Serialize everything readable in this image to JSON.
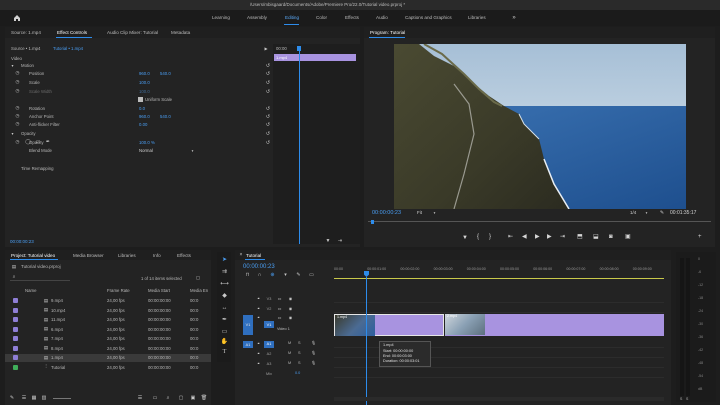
{
  "titlebar": {
    "path": "/Users/mbisgaard/Documents/Adobe/Premiere Pro/22.0/Tutorial video.prproj *"
  },
  "workspaces": [
    "Learning",
    "Assembly",
    "Editing",
    "Color",
    "Effects",
    "Audio",
    "Captions and Graphics",
    "Libraries"
  ],
  "workspace_active": "Editing",
  "source_tabs": [
    "Source: 1.mp4",
    "Effect Controls",
    "Audio Clip Mixer: Tutorial",
    "Metadata"
  ],
  "effect_controls": {
    "header": "Source • 1.mp4",
    "header_link": "Tutorial • 1.mp4",
    "section": "Video",
    "rows": [
      {
        "label": "Motion",
        "value": "",
        "value2": ""
      },
      {
        "label": "Position",
        "value": "960.0",
        "value2": "540.0"
      },
      {
        "label": "Scale",
        "value": "100.0",
        "value2": ""
      },
      {
        "label": "Scale Width",
        "value": "100.0",
        "value2": ""
      },
      {
        "label": "Uniform Scale",
        "value": "",
        "value2": ""
      },
      {
        "label": "Rotation",
        "value": "0.0",
        "value2": ""
      },
      {
        "label": "Anchor Point",
        "value": "960.0",
        "value2": "540.0"
      },
      {
        "label": "Anti-flicker Filter",
        "value": "0.00",
        "value2": ""
      },
      {
        "label": "Opacity",
        "value": "",
        "value2": ""
      },
      {
        "label": "Opacity",
        "value": "100.0 %",
        "value2": ""
      },
      {
        "label": "Blend Mode",
        "value": "Normal",
        "value2": ""
      },
      {
        "label": "Time Remapping",
        "value": "",
        "value2": ""
      }
    ],
    "mini_time": "00:00",
    "mini_clip": "1.mp4",
    "timecode": "00:00:00:23"
  },
  "program": {
    "title": "Program: Tutorial",
    "timecode": "00:00:00:23",
    "fit": "Fit",
    "fraction": "1/4",
    "duration": "00:01:35:17"
  },
  "project": {
    "tabs": [
      "Project: Tutorial video",
      "Media Browser",
      "Libraries",
      "Info",
      "Effects"
    ],
    "file": "Tutorial video.prproj",
    "selected_count": "1 of 14 items selected",
    "columns": [
      "Name",
      "Frame Rate",
      "Media Start",
      "Media En"
    ],
    "items": [
      {
        "name": "9.mp4",
        "rate": "24,00 fps",
        "start": "00:00:00:00",
        "end": "00:0",
        "color": "#8e7ed6"
      },
      {
        "name": "10.mp4",
        "rate": "24,00 fps",
        "start": "00:00:00:00",
        "end": "00:0",
        "color": "#8e7ed6"
      },
      {
        "name": "11.mp4",
        "rate": "24,00 fps",
        "start": "00:00:00:00",
        "end": "00:0",
        "color": "#8e7ed6"
      },
      {
        "name": "6.mp4",
        "rate": "24,00 fps",
        "start": "00:00:00:00",
        "end": "00:0",
        "color": "#8e7ed6"
      },
      {
        "name": "7.mp4",
        "rate": "24,00 fps",
        "start": "00:00:00:00",
        "end": "00:0",
        "color": "#8e7ed6"
      },
      {
        "name": "8.mp4",
        "rate": "24,00 fps",
        "start": "00:00:00:00",
        "end": "00:0",
        "color": "#8e7ed6"
      },
      {
        "name": "1.mp4",
        "rate": "24,00 fps",
        "start": "00:00:00:00",
        "end": "00:0",
        "color": "#8e7ed6"
      },
      {
        "name": "Tutorial",
        "rate": "24,00 fps",
        "start": "00:00:00:00",
        "end": "00:0",
        "color": "#3fae5a"
      }
    ]
  },
  "timeline": {
    "title": "Tutorial",
    "timecode": "00:00:00:23",
    "ruler": [
      "00:00",
      "00:00:01:00",
      "00:00:02:00",
      "00:00:03:00",
      "00:00:04:00",
      "00:00:05:00",
      "00:00:06:00",
      "00:00:07:00",
      "00:00:08:00",
      "00:00:09:00"
    ],
    "tracks": [
      "V3",
      "V2",
      "V1",
      "A1",
      "A2",
      "A3",
      "Mix"
    ],
    "track_label": "Video 1",
    "mix_value": "0.0",
    "src_v": "V1",
    "src_a": "A1",
    "clips": [
      {
        "name": "1.mp4",
        "label": "1.mp4"
      },
      {
        "name": "2.mp4",
        "label": "2.mp4"
      }
    ],
    "tooltip": {
      "name": "1.mp4",
      "start": "Start: 00:00:00:00",
      "end": "End: 00:00:03:00",
      "duration": "Duration: 00:00:03:01"
    }
  },
  "meter_labels": [
    "0",
    "-6",
    "-12",
    "-18",
    "-24",
    "-30",
    "-36",
    "-42",
    "-48",
    "-54",
    "dB"
  ]
}
